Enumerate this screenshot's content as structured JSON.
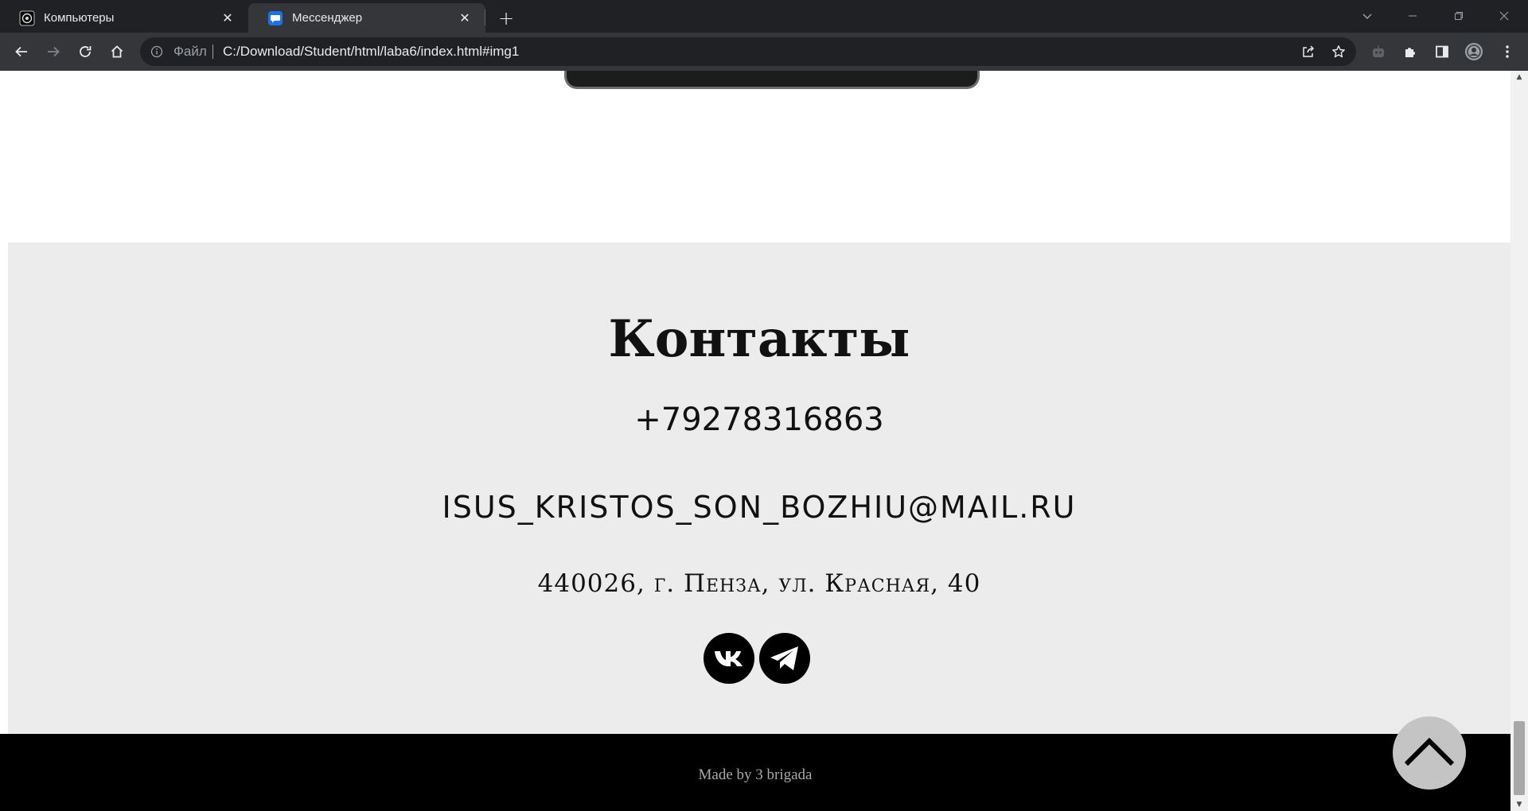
{
  "browser": {
    "tabs": [
      {
        "title": "Компьютеры",
        "active": false,
        "favicon": "site-logo-icon"
      },
      {
        "title": "Мессенджер",
        "active": true,
        "favicon": "chat-bubble-icon"
      }
    ],
    "address": {
      "scheme_label": "Файл",
      "url": "C:/Download/Student/html/laba6/index.html#img1"
    },
    "toolbar_icons": [
      "back-icon",
      "forward-icon",
      "reload-icon",
      "home-icon",
      "share-icon",
      "bookmark-star-icon",
      "robot-extension-icon",
      "puzzle-extensions-icon",
      "side-panel-icon",
      "profile-avatar-icon",
      "menu-dots-icon"
    ]
  },
  "contacts": {
    "title": "Контакты",
    "phone": "+79278316863",
    "email": "isus_kristos_son_bozhiu@mail.ru",
    "address": "440026, г. Пенза, ул. Красная, 40",
    "socials": [
      "vk-icon",
      "telegram-icon"
    ]
  },
  "footer": {
    "text": "Made by 3 brigada"
  },
  "colors": {
    "contacts_bg": "#ececec",
    "footer_bg": "#000000",
    "footer_text": "#a8a8a8",
    "to_top_button": "#c4c4c4"
  }
}
